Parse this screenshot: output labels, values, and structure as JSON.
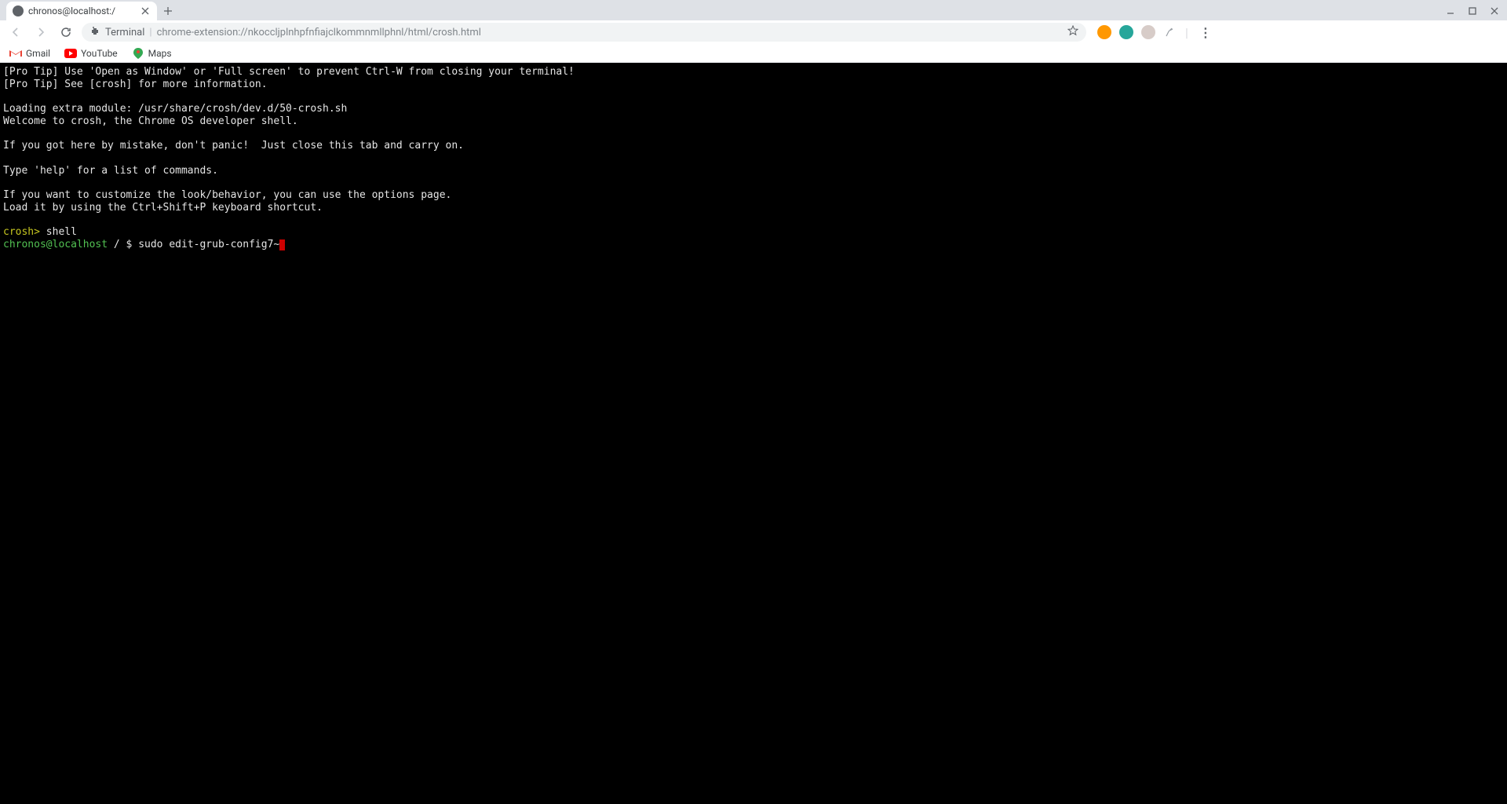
{
  "tab": {
    "title": "chronos@localhost:/"
  },
  "address": {
    "prefix": "Terminal",
    "url": "chrome-extension://nkoccljplnhpfnfiajclkommnmllphnl/html/crosh.html"
  },
  "bookmarks": [
    {
      "label": "Gmail"
    },
    {
      "label": "YouTube"
    },
    {
      "label": "Maps"
    }
  ],
  "terminal": {
    "lines": [
      "[Pro Tip] Use 'Open as Window' or 'Full screen' to prevent Ctrl-W from closing your terminal!",
      "[Pro Tip] See [crosh] for more information.",
      "",
      "Loading extra module: /usr/share/crosh/dev.d/50-crosh.sh",
      "Welcome to crosh, the Chrome OS developer shell.",
      "",
      "If you got here by mistake, don't panic!  Just close this tab and carry on.",
      "",
      "Type 'help' for a list of commands.",
      "",
      "If you want to customize the look/behavior, you can use the options page.",
      "Load it by using the Ctrl+Shift+P keyboard shortcut.",
      ""
    ],
    "crosh_prompt": "crosh>",
    "crosh_cmd": "shell",
    "user_host": "chronos@localhost",
    "path": "/",
    "dollar": "$",
    "command": "sudo edit-grub-config7~"
  }
}
